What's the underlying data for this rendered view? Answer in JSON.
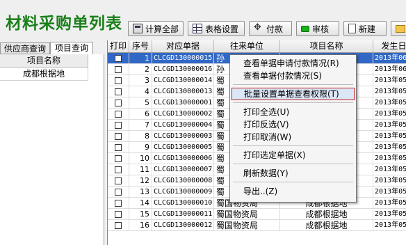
{
  "title": "材料采购单列表",
  "toolbar": {
    "calc_all": "计算全部",
    "table_settings": "表格设置",
    "pay": "付款",
    "audit": "审核",
    "new": "新建"
  },
  "left_tabs": [
    "供应商查询",
    "项目查询"
  ],
  "left_table": {
    "header": "项目名称",
    "rows": [
      "成都根据地"
    ]
  },
  "columns": [
    "打印",
    "序号",
    "对应单据",
    "往来单位",
    "项目名称",
    "发生日"
  ],
  "rows": [
    {
      "seq": "1",
      "doc": "CLCGD130000015",
      "unit": "孙",
      "project": "",
      "date": "2013年06"
    },
    {
      "seq": "2",
      "doc": "CLCGD130000016",
      "unit": "孙",
      "project": "",
      "date": "2013年06"
    },
    {
      "seq": "3",
      "doc": "CLCGD130000014",
      "unit": "蜀",
      "project": "",
      "date": "2013年05"
    },
    {
      "seq": "4",
      "doc": "CLCGD130000013",
      "unit": "蜀",
      "project": "",
      "date": "2013年05"
    },
    {
      "seq": "5",
      "doc": "CLCGD130000001",
      "unit": "蜀",
      "project": "",
      "date": "2013年05"
    },
    {
      "seq": "6",
      "doc": "CLCGD130000002",
      "unit": "蜀",
      "project": "",
      "date": "2013年05"
    },
    {
      "seq": "7",
      "doc": "CLCGD130000004",
      "unit": "蜀",
      "project": "",
      "date": "2013年05"
    },
    {
      "seq": "8",
      "doc": "CLCGD130000003",
      "unit": "蜀",
      "project": "",
      "date": "2013年05"
    },
    {
      "seq": "9",
      "doc": "CLCGD130000005",
      "unit": "蜀",
      "project": "",
      "date": "2013年05"
    },
    {
      "seq": "10",
      "doc": "CLCGD130000006",
      "unit": "蜀",
      "project": "",
      "date": "2013年05"
    },
    {
      "seq": "11",
      "doc": "CLCGD130000007",
      "unit": "蜀",
      "project": "",
      "date": "2013年05"
    },
    {
      "seq": "12",
      "doc": "CLCGD130000008",
      "unit": "蜀",
      "project": "",
      "date": "2013年05"
    },
    {
      "seq": "13",
      "doc": "CLCGD130000009",
      "unit": "蜀",
      "project": "",
      "date": "2013年05"
    },
    {
      "seq": "14",
      "doc": "CLCGD130000010",
      "unit": "蜀国物资局",
      "project": "成都根据地",
      "date": "2013年05"
    },
    {
      "seq": "15",
      "doc": "CLCGD130000011",
      "unit": "蜀国物资局",
      "project": "成都根据地",
      "date": "2013年05"
    },
    {
      "seq": "16",
      "doc": "CLCGD130000012",
      "unit": "蜀国物资局",
      "project": "成都根据地",
      "date": "2013年05"
    }
  ],
  "context_menu": [
    {
      "label": "查看单据申请付款情况(R)"
    },
    {
      "label": "查看单据付款情况(S)"
    },
    {
      "separator": true
    },
    {
      "label": "批量设置单据查看权限(T)",
      "highlighted": true
    },
    {
      "separator": true
    },
    {
      "label": "打印全选(U)"
    },
    {
      "label": "打印反选(V)"
    },
    {
      "label": "打印取消(W)"
    },
    {
      "separator": true
    },
    {
      "label": "打印选定单据(X)"
    },
    {
      "separator": true
    },
    {
      "label": "刷新数据(Y)"
    },
    {
      "separator": true
    },
    {
      "label": "导出..(Z)"
    }
  ],
  "colors": {
    "title_green": "#1a7f1a",
    "selection": "#3168c6",
    "menu_highlight_border": "#c21b1b"
  }
}
